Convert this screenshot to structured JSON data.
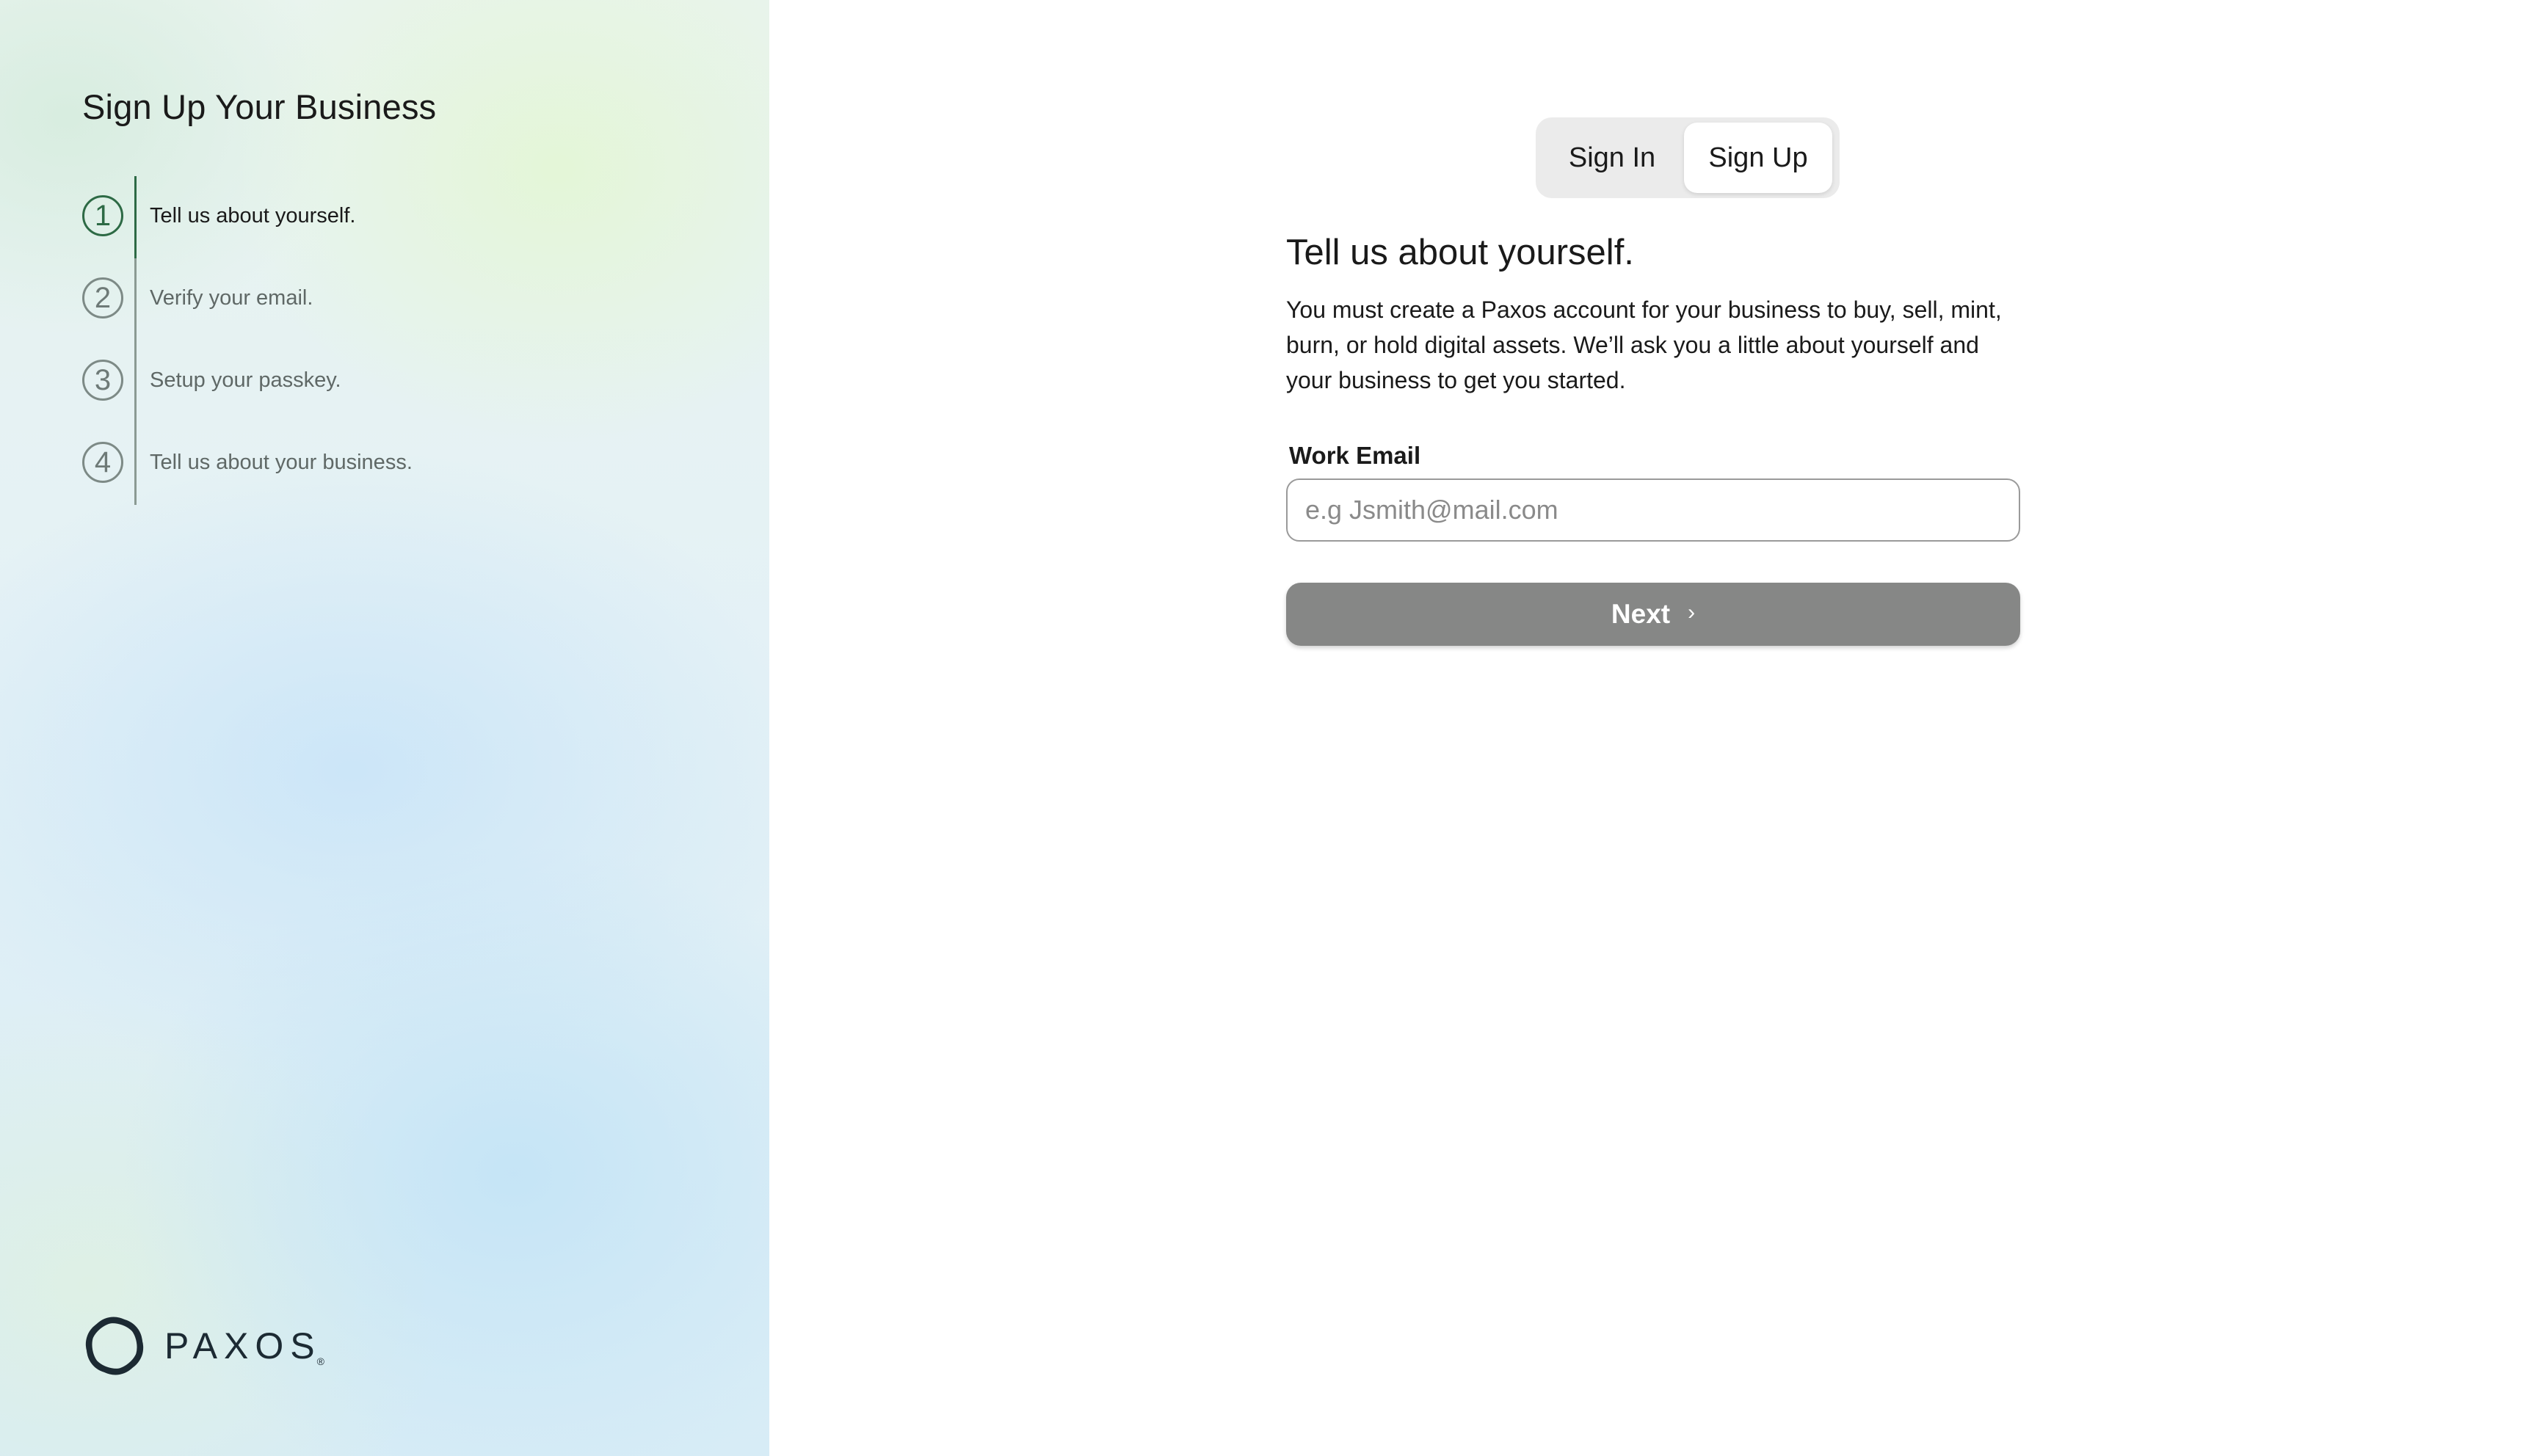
{
  "sidebar": {
    "title": "Sign Up Your Business",
    "steps": [
      {
        "number": "1",
        "label": "Tell us about yourself.",
        "active": true
      },
      {
        "number": "2",
        "label": "Verify your email.",
        "active": false
      },
      {
        "number": "3",
        "label": "Setup your passkey.",
        "active": false
      },
      {
        "number": "4",
        "label": "Tell us about your business.",
        "active": false
      }
    ],
    "logo": {
      "text": "PAXOS",
      "registered": "®"
    }
  },
  "auth_toggle": {
    "sign_in_label": "Sign In",
    "sign_up_label": "Sign Up",
    "selected": "Sign Up"
  },
  "form": {
    "heading": "Tell us about yourself.",
    "description": "You must create a Paxos account for your business to buy, sell, mint, burn, or hold digital assets. We’ll ask you a little about yourself and your business to get you started.",
    "email_label": "Work Email",
    "email_value": "",
    "email_placeholder": "e.g Jsmith@mail.com",
    "next_label": "Next",
    "next_icon": "chevron-right-icon"
  },
  "colors": {
    "step_active": "#2d6a45",
    "step_inactive": "#7d8a86",
    "next_button_bg": "#868786",
    "toggle_bg": "#ebebeb"
  }
}
